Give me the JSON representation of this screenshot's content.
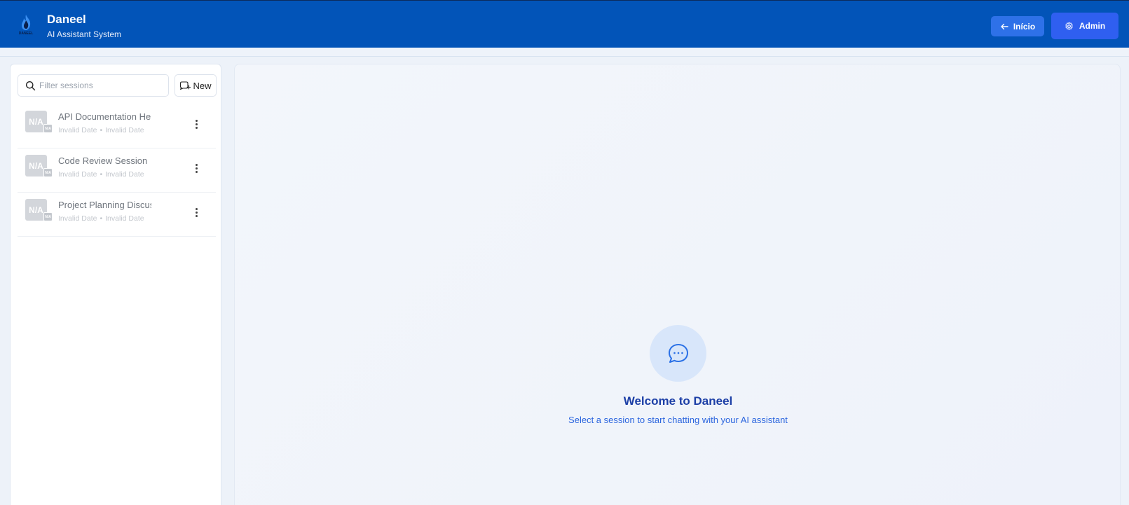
{
  "header": {
    "title": "Daneel",
    "subtitle": "AI Assistant System",
    "logo_text": "DANEEL",
    "logo_icon": "flame-logo-icon",
    "inicio_label": "Início",
    "admin_label": "Admin",
    "inicio_icon": "arrow-left-icon",
    "admin_icon": "gear-icon"
  },
  "sidebar": {
    "search_placeholder": "Filter sessions",
    "new_label": "New",
    "sessions": [
      {
        "title": "API Documentation He",
        "avatar": "N/A",
        "badge": "N/A",
        "created": "Invalid Date",
        "updated": "Invalid Date"
      },
      {
        "title": "Code Review Session",
        "avatar": "N/A",
        "badge": "N/A",
        "created": "Invalid Date",
        "updated": "Invalid Date"
      },
      {
        "title": "Project Planning Discus",
        "avatar": "N/A",
        "badge": "N/A",
        "created": "Invalid Date",
        "updated": "Invalid Date"
      }
    ],
    "meta_separator": "•"
  },
  "main": {
    "welcome_title": "Welcome to Daneel",
    "welcome_subtitle": "Select a session to start chatting with your AI assistant",
    "icon": "chat-bubble-icon"
  },
  "colors": {
    "header_bg": "#0254b8",
    "accent": "#2f5ff0",
    "welcome_title": "#1c3fa6",
    "welcome_sub": "#2c66de"
  }
}
